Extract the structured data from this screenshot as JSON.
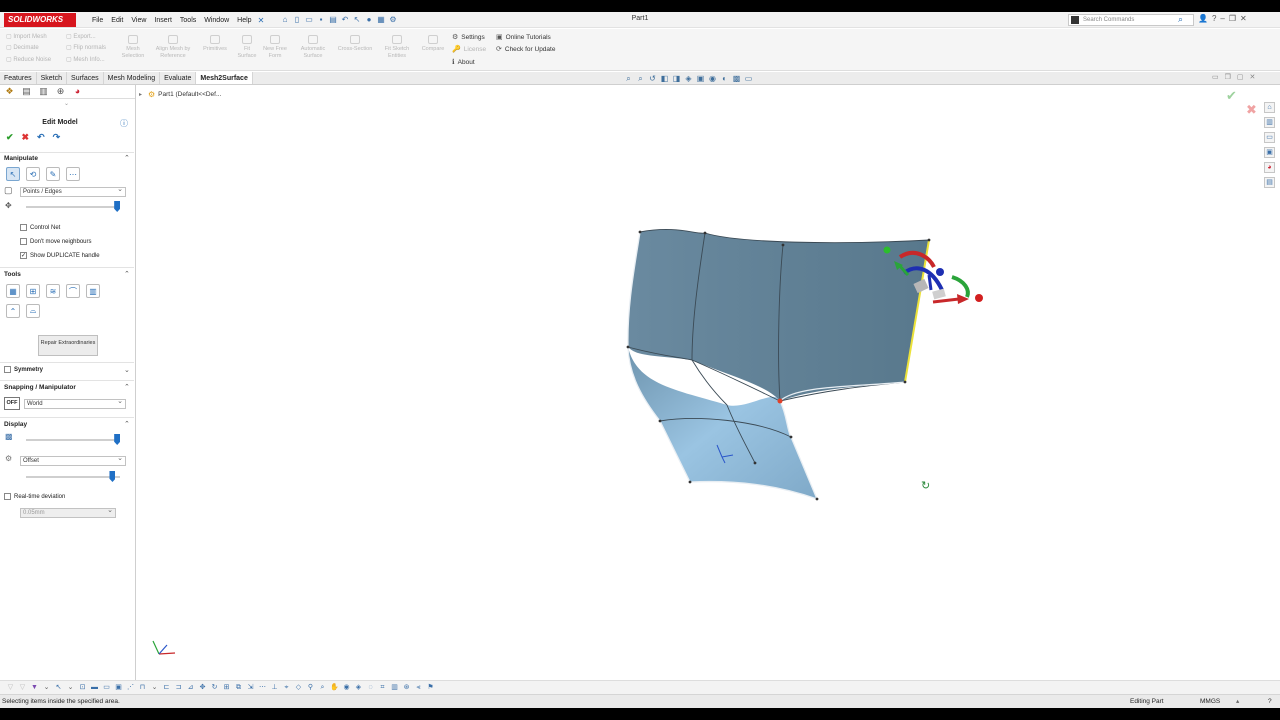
{
  "app": {
    "logo": "SOLIDWORKS",
    "document_title": "Part1"
  },
  "menu": [
    "File",
    "Edit",
    "View",
    "Insert",
    "Tools",
    "Window",
    "Help"
  ],
  "search": {
    "placeholder": "Search Commands"
  },
  "commands": {
    "import_mesh": "Import Mesh",
    "export": "Export...",
    "decimate": "Decimate",
    "flip_normals": "Flip normals",
    "reduce_noise": "Reduce Noise",
    "mesh_info": "Mesh Info...",
    "mesh_selection": "Mesh Selection",
    "align_mesh": "Align Mesh by Reference",
    "primitives": "Primitives",
    "fit_surface": "Fit Surface",
    "new_free_form": "New Free Form",
    "automatic_surface": "Automatic Surface",
    "cross_section": "Cross-Section",
    "fit_sketch_entities": "Fit Sketch Entities",
    "compare": "Compare",
    "settings": "Settings",
    "license": "License",
    "about": "About",
    "online_tutorials": "Online Tutorials",
    "check_for_update": "Check for Update"
  },
  "tabs": [
    {
      "label": "Features",
      "active": false
    },
    {
      "label": "Sketch",
      "active": false
    },
    {
      "label": "Surfaces",
      "active": false
    },
    {
      "label": "Mesh Modeling",
      "active": false
    },
    {
      "label": "Evaluate",
      "active": false
    },
    {
      "label": "Mesh2Surface",
      "active": true
    }
  ],
  "panel": {
    "title": "Edit Model",
    "manipulate": {
      "heading": "Manipulate",
      "selection_mode": "Points / Edges",
      "slider_value": 0.97,
      "options": [
        {
          "label": "Control Net",
          "checked": false
        },
        {
          "label": "Don't move neighbours",
          "checked": false
        },
        {
          "label": "Show DUPLICATE handle",
          "checked": true
        }
      ]
    },
    "tools": {
      "heading": "Tools",
      "repair_label": "Repair Extraordinaries"
    },
    "symmetry": {
      "heading": "Symmetry",
      "checked": false
    },
    "snapping": {
      "heading": "Snapping / Manipulator",
      "toggle": "OFF",
      "coordinate_system": "World"
    },
    "display": {
      "heading": "Display",
      "slider1_value": 0.97,
      "mode": "Offset",
      "slider2_value": 0.92,
      "realtime_label": "Real-time deviation",
      "realtime_checked": false,
      "deviation_value": "0.05mm"
    }
  },
  "tree": {
    "root": "Part1  (Default<<Def..."
  },
  "status": {
    "message": "Selecting items inside the specified area.",
    "mode": "Editing Part",
    "units": "MMGS",
    "help": "?"
  },
  "colors": {
    "surface": "#5e7f94",
    "surface_light": "#8fb8d6",
    "accent": "#1f6fc5",
    "brand": "#d7161e"
  }
}
